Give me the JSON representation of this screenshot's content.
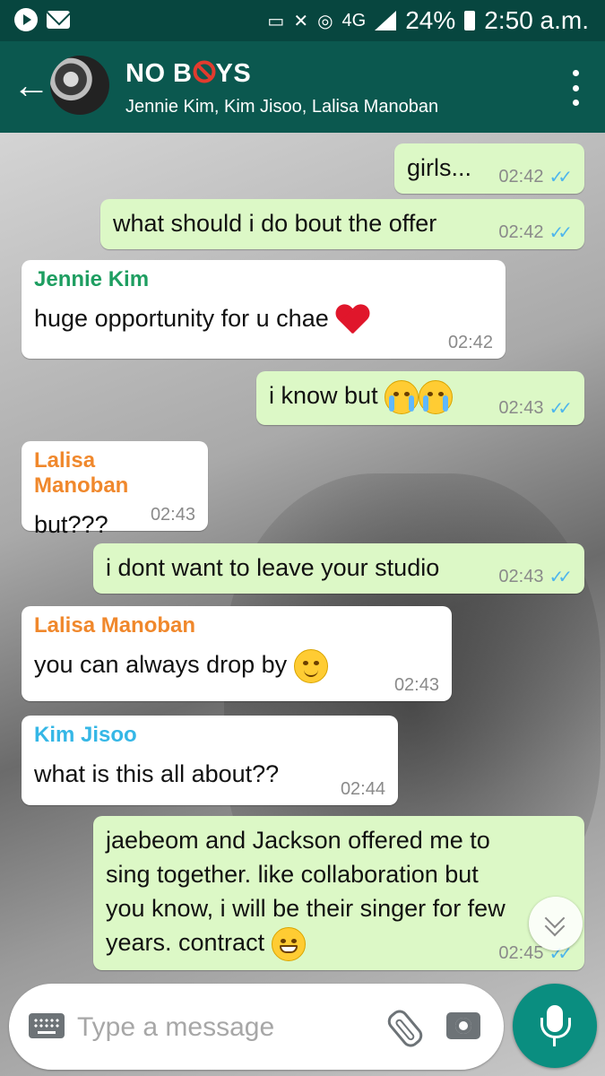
{
  "status_bar": {
    "network": "4G",
    "battery": "24%",
    "time": "2:50 a.m."
  },
  "header": {
    "title_prefix": "NO B",
    "title_suffix": "YS",
    "title_emoji": "no-entry-icon",
    "members": "Jennie Kim, Kim Jisoo, Lalisa Manoban"
  },
  "messages": [
    {
      "direction": "out",
      "text": "girls...",
      "time": "02:42",
      "status": "read"
    },
    {
      "direction": "out",
      "text": "what should i do bout the offer",
      "time": "02:42",
      "status": "read"
    },
    {
      "direction": "in",
      "sender": "Jennie Kim",
      "sender_color": "#1e9e61",
      "text": "huge opportunity for u chae",
      "emoji": "red-heart",
      "time": "02:42"
    },
    {
      "direction": "out",
      "text": "i know but",
      "emoji": "loudly-crying-face x2",
      "time": "02:43",
      "status": "read"
    },
    {
      "direction": "in",
      "sender": "Lalisa Manoban",
      "sender_color": "#f0882c",
      "text": "but???",
      "time": "02:43"
    },
    {
      "direction": "out",
      "text": "i dont want to leave your studio",
      "time": "02:43",
      "status": "read"
    },
    {
      "direction": "in",
      "sender": "Lalisa Manoban",
      "sender_color": "#f0882c",
      "text": "you can always drop by",
      "emoji": "relieved-face",
      "time": "02:43"
    },
    {
      "direction": "in",
      "sender": "Kim Jisoo",
      "sender_color": "#35b7e6",
      "text": "what is this all about??",
      "time": "02:44"
    },
    {
      "direction": "out",
      "lines": [
        "jaebeom and Jackson offered me to",
        "sing together. like collaboration but",
        "you know, i will be their singer for few",
        "years. contract"
      ],
      "emoji": "grinning-face",
      "time": "02:45",
      "status": "read"
    }
  ],
  "composer": {
    "placeholder": "Type a message"
  }
}
